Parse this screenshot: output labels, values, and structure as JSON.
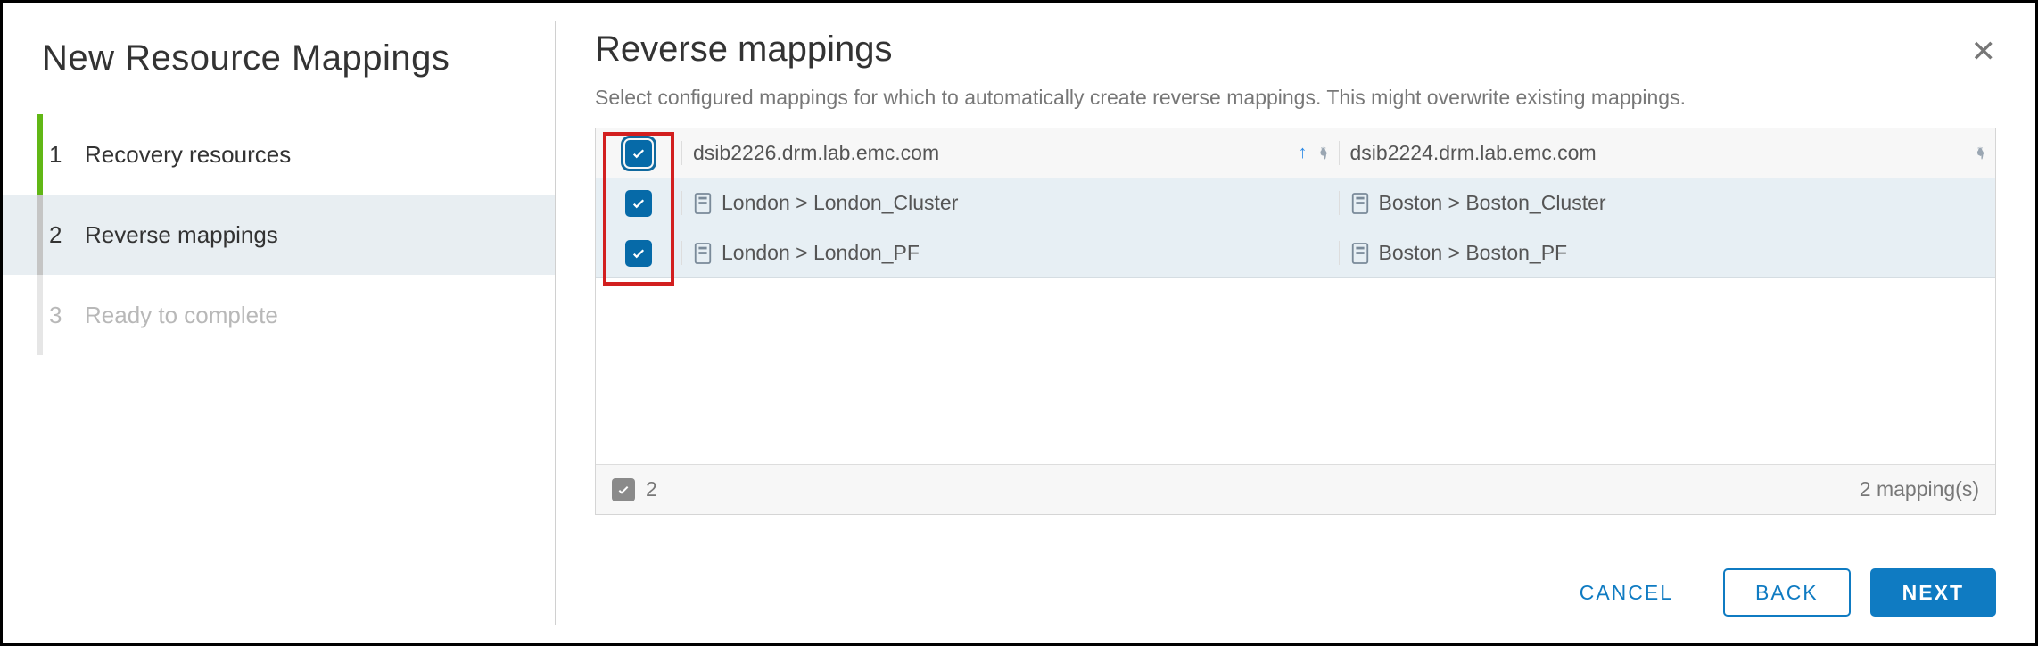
{
  "wizard": {
    "title": "New Resource Mappings",
    "steps": [
      {
        "num": "1",
        "label": "Recovery resources",
        "state": "done"
      },
      {
        "num": "2",
        "label": "Reverse mappings",
        "state": "active"
      },
      {
        "num": "3",
        "label": "Ready to complete",
        "state": "disabled"
      }
    ]
  },
  "page": {
    "title": "Reverse mappings",
    "description": "Select configured mappings for which to automatically create reverse mappings. This might overwrite existing mappings."
  },
  "table": {
    "col1_header": "dsib2226.drm.lab.emc.com",
    "col2_header": "dsib2224.drm.lab.emc.com",
    "rows": [
      {
        "checked": true,
        "src": "London > London_Cluster",
        "dst": "Boston > Boston_Cluster"
      },
      {
        "checked": true,
        "src": "London > London_PF",
        "dst": "Boston > Boston_PF"
      }
    ],
    "selected_count": "2",
    "footer_total": "2 mapping(s)"
  },
  "buttons": {
    "cancel": "CANCEL",
    "back": "BACK",
    "next": "NEXT"
  }
}
